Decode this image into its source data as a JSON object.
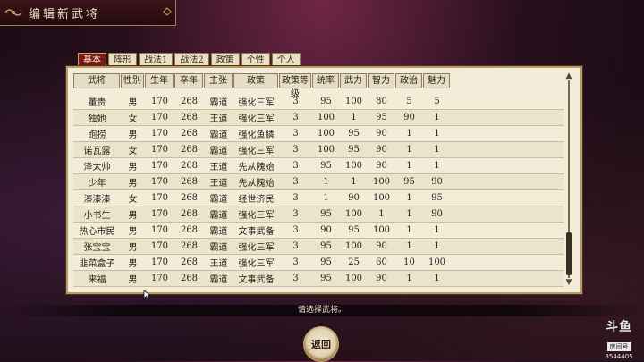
{
  "title": "编辑新武将",
  "tabs": [
    "基本",
    "阵形",
    "战法1",
    "战法2",
    "政策",
    "个性",
    "个人"
  ],
  "active_tab": 0,
  "columns": [
    "武将",
    "性别",
    "生年",
    "卒年",
    "主张",
    "政策",
    "政策等级",
    "统率",
    "武力",
    "智力",
    "政治",
    "魅力"
  ],
  "partial_row": [
    "",
    "",
    "170",
    "268",
    "霸道",
    "强化三军",
    "",
    "",
    "",
    "",
    "",
    ""
  ],
  "rows": [
    [
      "董贵",
      "男",
      "170",
      "268",
      "霸道",
      "强化三军",
      "3",
      "95",
      "100",
      "80",
      "5",
      "5"
    ],
    [
      "独她",
      "女",
      "170",
      "268",
      "王道",
      "强化三军",
      "3",
      "100",
      "1",
      "95",
      "90",
      "1"
    ],
    [
      "跑捞",
      "男",
      "170",
      "268",
      "霸道",
      "强化鱼鳞",
      "3",
      "100",
      "95",
      "90",
      "1",
      "1"
    ],
    [
      "诺瓦露",
      "女",
      "170",
      "268",
      "霸道",
      "强化三军",
      "3",
      "100",
      "95",
      "90",
      "1",
      "1"
    ],
    [
      "泽太帅",
      "男",
      "170",
      "268",
      "王道",
      "先从隗始",
      "3",
      "95",
      "100",
      "90",
      "1",
      "1"
    ],
    [
      "少年",
      "男",
      "170",
      "268",
      "王道",
      "先从隗始",
      "3",
      "1",
      "1",
      "100",
      "95",
      "90"
    ],
    [
      "溱溱溱",
      "女",
      "170",
      "268",
      "霸道",
      "经世济民",
      "3",
      "1",
      "90",
      "100",
      "1",
      "95"
    ],
    [
      "小书生",
      "男",
      "170",
      "268",
      "霸道",
      "强化三军",
      "3",
      "95",
      "100",
      "1",
      "1",
      "90"
    ],
    [
      "热心市民",
      "男",
      "170",
      "268",
      "霸道",
      "文事武备",
      "3",
      "90",
      "95",
      "100",
      "1",
      "1"
    ],
    [
      "张宝宝",
      "男",
      "170",
      "268",
      "霸道",
      "强化三军",
      "3",
      "95",
      "100",
      "90",
      "1",
      "1"
    ],
    [
      "韭菜盒子",
      "男",
      "170",
      "268",
      "王道",
      "强化三军",
      "3",
      "95",
      "25",
      "60",
      "10",
      "100"
    ],
    [
      "来福",
      "男",
      "170",
      "268",
      "霸道",
      "文事武备",
      "3",
      "95",
      "100",
      "90",
      "1",
      "1"
    ]
  ],
  "prompt": "请选择武将。",
  "back_label": "返回",
  "watermark": {
    "logo": "斗鱼",
    "sub": "房间号",
    "room": "8544405"
  },
  "colors": {
    "accent": "#7a1a16",
    "panel": "#f3ecd8",
    "border": "#b89a64"
  }
}
